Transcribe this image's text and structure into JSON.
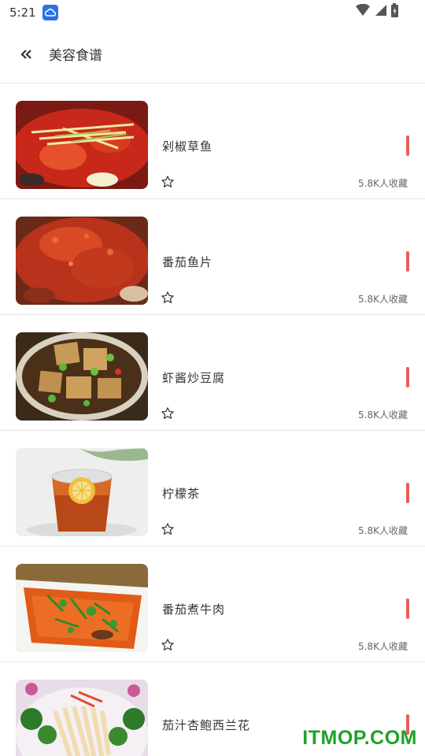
{
  "status_bar": {
    "time": "5:21"
  },
  "header": {
    "title": "美容食谱",
    "back_icon": "double-chevron-left-icon"
  },
  "recipes": [
    {
      "title": "剁椒草鱼",
      "favorites": "5.8K人收藏"
    },
    {
      "title": "番茄鱼片",
      "favorites": "5.8K人收藏"
    },
    {
      "title": "虾酱炒豆腐",
      "favorites": "5.8K人收藏"
    },
    {
      "title": "柠檬茶",
      "favorites": "5.8K人收藏"
    },
    {
      "title": "番茄煮牛肉",
      "favorites": "5.8K人收藏"
    },
    {
      "title": "茄汁杏鲍西兰花",
      "favorites": ""
    }
  ],
  "watermark": "ITMOP.COM",
  "colors": {
    "accent_bar": "#e85d5d",
    "watermark": "#1fa12a",
    "cloud_badge": "#2f6fe8"
  }
}
